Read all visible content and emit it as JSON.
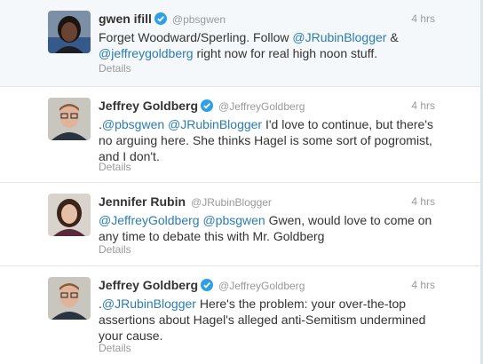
{
  "colors": {
    "link": "#2a7cb2",
    "meta": "#999999",
    "verified": "#2fa0e4"
  },
  "tweets": [
    {
      "fullname": "gwen ifill",
      "verified": true,
      "handle": "@pbsgwen",
      "time": "4 hrs",
      "avatar": "person-photo-woman-dark-hair",
      "parts": [
        {
          "t": "Forget Woodward/Sperling. Follow "
        },
        {
          "m": "@JRubinBlogger"
        },
        {
          "t": " & "
        },
        {
          "m": "@jeffreygoldberg"
        },
        {
          "t": " right now for real high noon stuff."
        }
      ],
      "details": "Details"
    },
    {
      "fullname": "Jeffrey Goldberg",
      "verified": true,
      "handle": "@JeffreyGoldberg",
      "time": "4 hrs",
      "avatar": "person-photo-man-glasses",
      "parts": [
        {
          "t": "."
        },
        {
          "m": "@pbsgwen"
        },
        {
          "t": " "
        },
        {
          "m": "@JRubinBlogger"
        },
        {
          "t": " I'd love to continue, but there's no arguing here. She thinks Hagel is some sort of pogromist, and I don't."
        }
      ],
      "details": "Details"
    },
    {
      "fullname": "Jennifer Rubin",
      "verified": false,
      "handle": "@JRubinBlogger",
      "time": "4 hrs",
      "avatar": "person-photo-woman-brown-hair",
      "parts": [
        {
          "m": "@JeffreyGoldberg"
        },
        {
          "t": " "
        },
        {
          "m": "@pbsgwen"
        },
        {
          "t": " Gwen, would love to come on any time to debate this with Mr. Goldberg"
        }
      ],
      "details": "Details"
    },
    {
      "fullname": "Jeffrey Goldberg",
      "verified": true,
      "handle": "@JeffreyGoldberg",
      "time": "4 hrs",
      "avatar": "person-photo-man-glasses",
      "parts": [
        {
          "t": "."
        },
        {
          "m": "@JRubinBlogger"
        },
        {
          "t": " Here's the problem: your over-the-top assertions about Hagel's alleged anti-Semitism undermined your cause."
        }
      ],
      "details": "Details"
    }
  ]
}
